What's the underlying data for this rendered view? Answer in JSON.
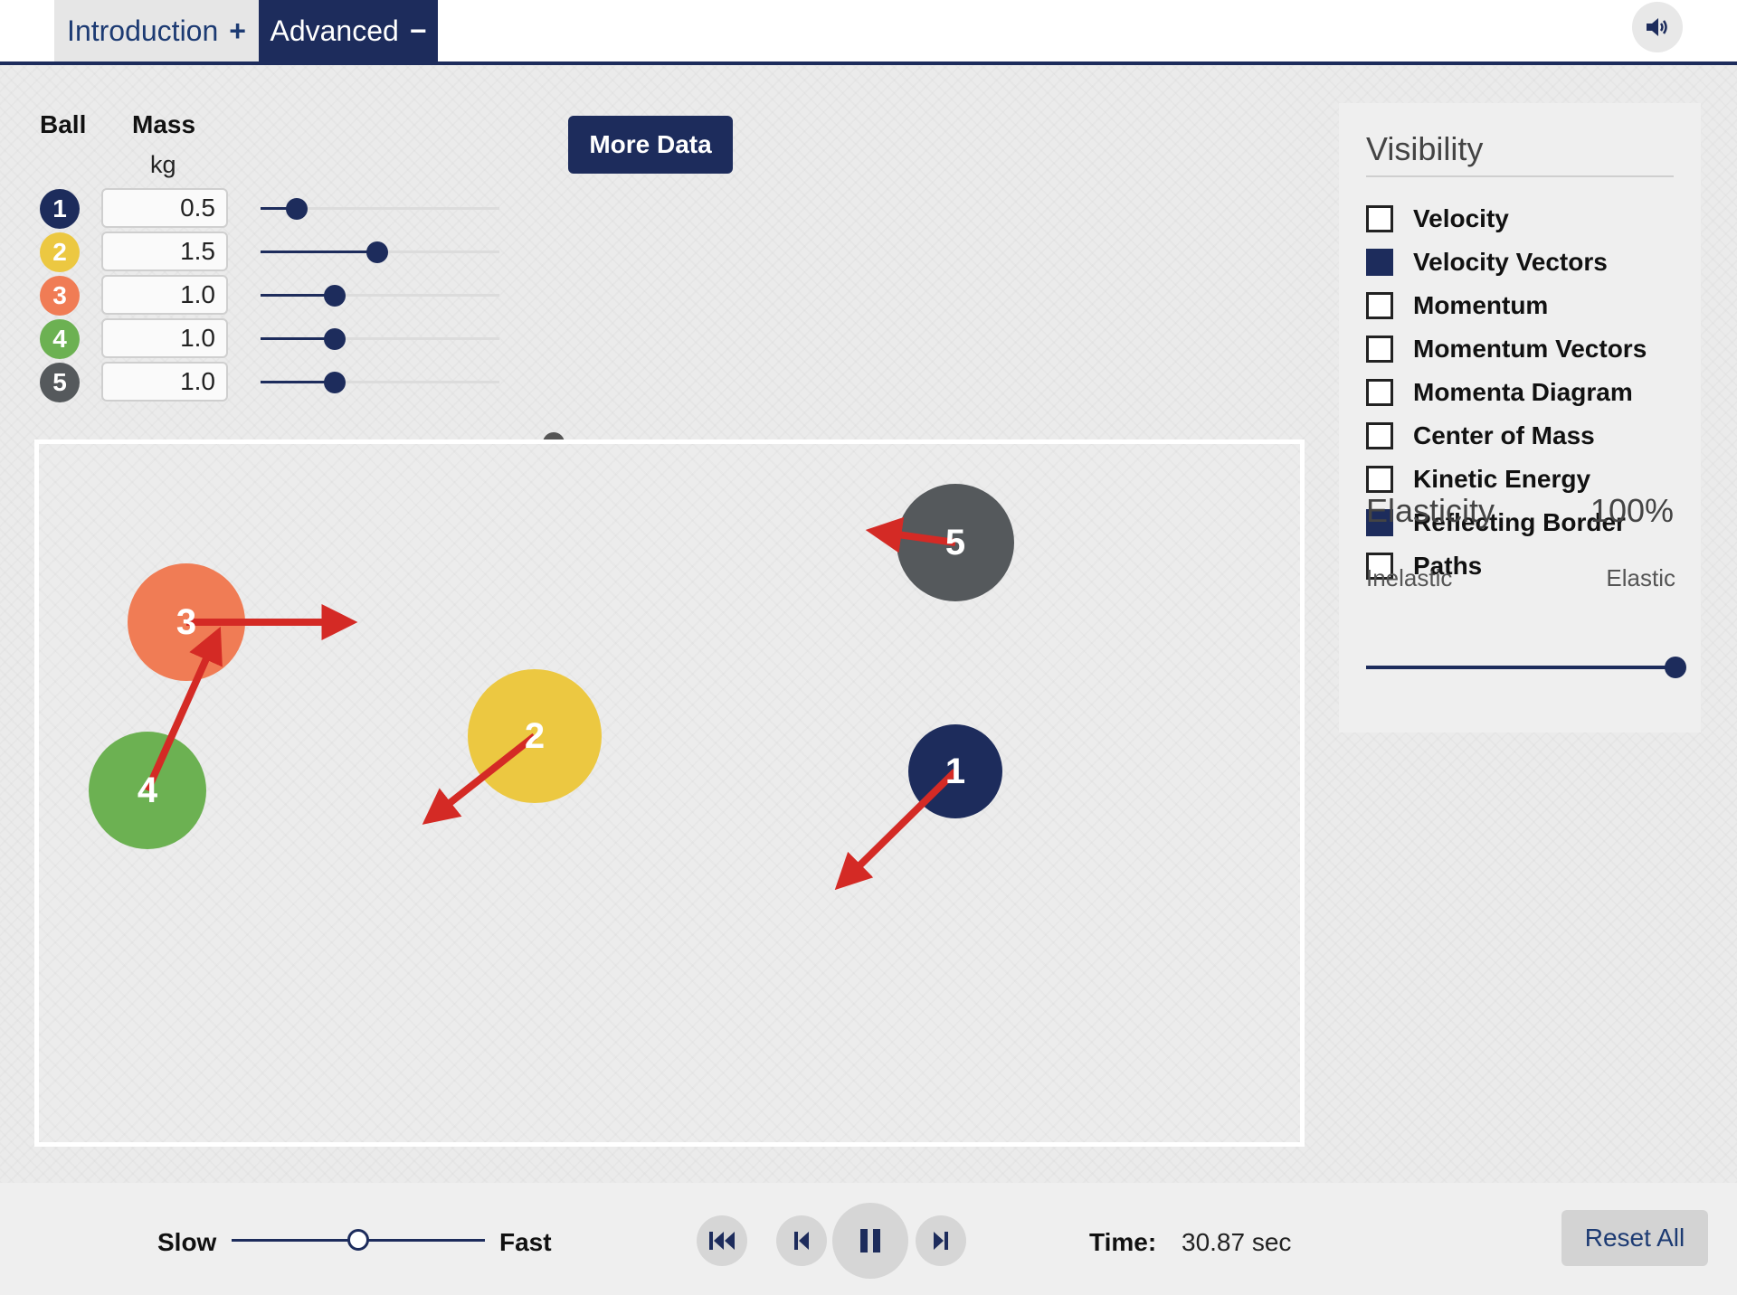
{
  "tabs": {
    "intro_label": "Introduction",
    "intro_sign": "+",
    "advanced_label": "Advanced",
    "advanced_sign": "−"
  },
  "table": {
    "ball_header": "Ball",
    "mass_header": "Mass",
    "mass_unit": "kg"
  },
  "balls": [
    {
      "number": "1",
      "mass": "0.5",
      "color": "#1d2c5c",
      "slider_fraction": 0.15
    },
    {
      "number": "2",
      "mass": "1.5",
      "color": "#ecc841",
      "slider_fraction": 0.49
    },
    {
      "number": "3",
      "mass": "1.0",
      "color": "#f07c55",
      "slider_fraction": 0.31
    },
    {
      "number": "4",
      "mass": "1.0",
      "color": "#6cb152",
      "slider_fraction": 0.31
    },
    {
      "number": "5",
      "mass": "1.0",
      "color": "#55595c",
      "slider_fraction": 0.31
    }
  ],
  "more_data_label": "More Data",
  "visibility": {
    "title": "Visibility",
    "options": [
      {
        "label": "Velocity",
        "checked": false
      },
      {
        "label": "Velocity Vectors",
        "checked": true
      },
      {
        "label": "Momentum",
        "checked": false
      },
      {
        "label": "Momentum Vectors",
        "checked": false
      },
      {
        "label": "Momenta Diagram",
        "checked": false
      },
      {
        "label": "Center of Mass",
        "checked": false
      },
      {
        "label": "Kinetic Energy",
        "checked": false
      },
      {
        "label": "Reflecting Border",
        "checked": true
      },
      {
        "label": "Paths",
        "checked": false
      }
    ]
  },
  "elasticity": {
    "label": "Elasticity",
    "value": "100%",
    "fraction": 1.0,
    "min_label": "Inelastic",
    "max_label": "Elastic"
  },
  "controls": {
    "slow_label": "Slow",
    "fast_label": "Fast",
    "speed_fraction": 0.5,
    "time_label": "Time:",
    "time_value": "30.87 sec",
    "reset_label": "Reset All"
  },
  "colors": {
    "primary": "#1d2c5c",
    "vector": "#d42a25"
  },
  "icons": [
    "sound-icon",
    "rewind-icon",
    "step-back-icon",
    "pause-icon",
    "step-forward-icon",
    "minus-icon"
  ]
}
